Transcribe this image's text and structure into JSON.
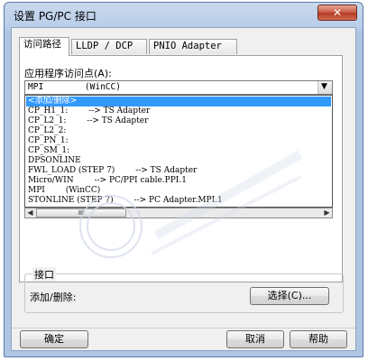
{
  "window": {
    "title": "设置 PG/PC 接口",
    "close_glyph": "✕"
  },
  "tabs": [
    {
      "label": "访问路径",
      "active": true
    },
    {
      "label": "LLDP / DCP",
      "active": false
    },
    {
      "label": "PNIO Adapter",
      "active": false
    }
  ],
  "access_point": {
    "label": "应用程序访问点(A):",
    "selected_value": "MPI        (WinCC)",
    "dropdown_glyph": "▼",
    "options": [
      "<添加/删除>",
      "CP_H1_1:        --> TS Adapter",
      "CP_L2_1:        --> TS Adapter",
      "CP_L2_2:",
      "CP_PN_1:",
      "CP_SM_1:",
      "DPSONLINE",
      "FWL_LOAD (STEP 7)        --> TS Adapter",
      "Micro/WIN        --> PC/PPI cable.PPI.1",
      "MPI        (WinCC)",
      "STONLINE (STEP 7)        --> PC Adapter.MPI.1"
    ],
    "highlighted_index": 0,
    "scroll_left_glyph": "◀",
    "scroll_right_glyph": "▶",
    "scroll_thumb_grip": "III"
  },
  "interface_group": {
    "title": "接口",
    "label": "添加/删除:",
    "select_button": "选择(C)..."
  },
  "footer": {
    "ok": "确定",
    "cancel": "取消",
    "help": "帮助"
  }
}
